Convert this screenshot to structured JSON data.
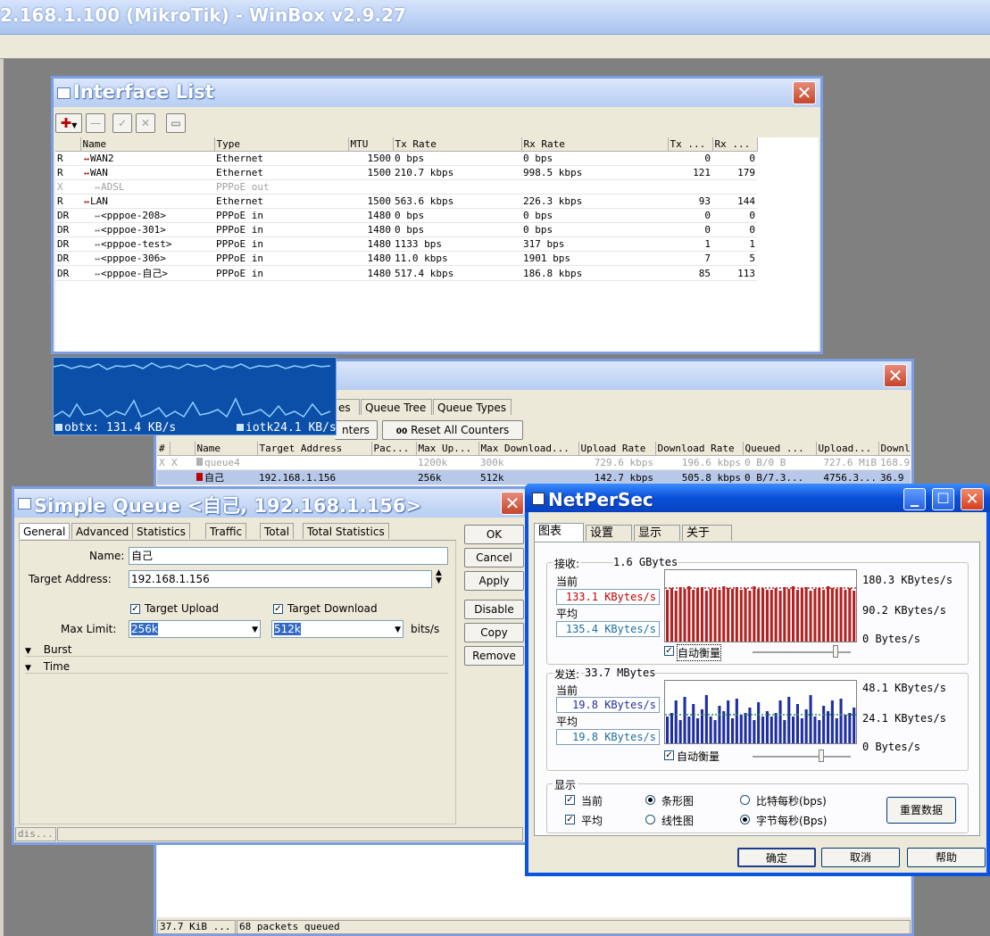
{
  "app": {
    "title": "2.168.1.100 (MikroTik) - WinBox v2.9.27"
  },
  "interface_list": {
    "title": "Interface List",
    "columns": [
      "Name",
      "Type",
      "MTU",
      "Tx Rate",
      "Rx Rate",
      "Tx ...",
      "Rx ..."
    ],
    "rows": [
      {
        "flag": "R",
        "name": "WAN2",
        "type": "Ethernet",
        "mtu": "1500",
        "tx": "0 bps",
        "rx": "0 bps",
        "txp": "0",
        "rxp": "0",
        "disabled": false,
        "indent": false
      },
      {
        "flag": "R",
        "name": "WAN",
        "type": "Ethernet",
        "mtu": "1500",
        "tx": "210.7 kbps",
        "rx": "998.5 kbps",
        "txp": "121",
        "rxp": "179",
        "disabled": false,
        "indent": false
      },
      {
        "flag": "X",
        "name": "ADSL",
        "type": "PPPoE out",
        "mtu": "",
        "tx": "",
        "rx": "",
        "txp": "",
        "rxp": "",
        "disabled": true,
        "indent": true
      },
      {
        "flag": "R",
        "name": "LAN",
        "type": "Ethernet",
        "mtu": "1500",
        "tx": "563.6 kbps",
        "rx": "226.3 kbps",
        "txp": "93",
        "rxp": "144",
        "disabled": false,
        "indent": false
      },
      {
        "flag": "DR",
        "name": "<pppoe-208>",
        "type": "PPPoE in",
        "mtu": "1480",
        "tx": "0 bps",
        "rx": "0 bps",
        "txp": "0",
        "rxp": "0",
        "disabled": false,
        "indent": true
      },
      {
        "flag": "DR",
        "name": "<pppoe-301>",
        "type": "PPPoE in",
        "mtu": "1480",
        "tx": "0 bps",
        "rx": "0 bps",
        "txp": "0",
        "rxp": "0",
        "disabled": false,
        "indent": true
      },
      {
        "flag": "DR",
        "name": "<pppoe-test>",
        "type": "PPPoE in",
        "mtu": "1480",
        "tx": "1133 bps",
        "rx": "317 bps",
        "txp": "1",
        "rxp": "1",
        "disabled": false,
        "indent": true
      },
      {
        "flag": "DR",
        "name": "<pppoe-306>",
        "type": "PPPoE in",
        "mtu": "1480",
        "tx": "11.0 kbps",
        "rx": "1901 bps",
        "txp": "7",
        "rxp": "5",
        "disabled": false,
        "indent": true
      },
      {
        "flag": "DR",
        "name": "<pppoe-自己>",
        "type": "PPPoE in",
        "mtu": "1480",
        "tx": "517.4 kbps",
        "rx": "186.8 kbps",
        "txp": "85",
        "rxp": "113",
        "disabled": false,
        "indent": true
      }
    ]
  },
  "mini_graph": {
    "tx_label": "obtx: 131.4 KB/s",
    "rx_label": "iotk24.1 KB/s"
  },
  "queue_list": {
    "tabs": [
      "es",
      "Queue Tree",
      "Queue Types"
    ],
    "reset_counters_partial": "nters",
    "reset_all_label": "Reset All Counters",
    "reset_all_icon_text": "00",
    "columns": [
      "#",
      "Name",
      "Target Address",
      "Pac...",
      "Max Up...",
      "Max Download...",
      "Upload Rate",
      "Download Rate",
      "Queued ...",
      "Upload...",
      "Downl"
    ],
    "rows": [
      {
        "idx": "X",
        "name": "queue4",
        "target": "",
        "pac": "",
        "maxup": "1200k",
        "maxdown": "300k",
        "uprate": "729.6 kbps",
        "downrate": "196.6 kbps",
        "queued": "0 B/0 B",
        "upload": "727.6 MiB",
        "down": "168.9",
        "disabled": true
      },
      {
        "idx": "",
        "name": "自己",
        "target": "192.168.1.156",
        "pac": "",
        "maxup": "256k",
        "maxdown": "512k",
        "uprate": "142.7 kbps",
        "downrate": "505.8 kbps",
        "queued": "0 B/7.3...",
        "upload": "4756.3...",
        "down": "36.9",
        "disabled": false
      }
    ],
    "status_left": "37.7 KiB ...",
    "status_right": "68 packets queued"
  },
  "simple_queue": {
    "title": "Simple Queue <自己, 192.168.1.156>",
    "tabs": [
      "General",
      "Advanced",
      "Statistics",
      "Traffic",
      "Total",
      "Total Statistics"
    ],
    "name_label": "Name:",
    "name_value": "自己",
    "target_label": "Target Address:",
    "target_value": "192.168.1.156",
    "upload_check_label": "Target Upload",
    "download_check_label": "Target Download",
    "max_limit_label": "Max Limit:",
    "max_up_value": "256k",
    "max_down_value": "512k",
    "units": "bits/s",
    "burst_label": "Burst",
    "time_label": "Time",
    "buttons": [
      "OK",
      "Cancel",
      "Apply",
      "Disable",
      "Copy",
      "Remove"
    ],
    "status": "dis..."
  },
  "netpersec": {
    "title": "NetPerSec",
    "tabs": [
      "图表",
      "设置",
      "显示",
      "关于"
    ],
    "recv": {
      "header": "接收:",
      "total": "1.6 GBytes",
      "current_label": "当前",
      "current_value": "133.1 KBytes/s",
      "avg_label": "平均",
      "avg_value": "135.4 KBytes/s",
      "scale_top": "180.3 KBytes/s",
      "scale_mid": "90.2 KBytes/s",
      "scale_bottom": "0  Bytes/s",
      "auto_scale": "自动衡量"
    },
    "send": {
      "header": "发送:",
      "total": "33.7 MBytes",
      "current_label": "当前",
      "current_value": "19.8 KBytes/s",
      "avg_label": "平均",
      "avg_value": "19.8 KBytes/s",
      "scale_top": "48.1 KBytes/s",
      "scale_mid": "24.1 KBytes/s",
      "scale_bottom": "0  Bytes/s",
      "auto_scale": "自动衡量"
    },
    "display": {
      "header": "显示",
      "show_current": "当前",
      "show_avg": "平均",
      "bar_chart": "条形图",
      "line_chart": "线性图",
      "bits": "比特每秒(bps)",
      "bytes": "字节每秒(Bps)",
      "reset": "重置数据"
    },
    "buttons": {
      "ok": "确定",
      "cancel": "取消",
      "help": "帮助"
    },
    "colors": {
      "recv_bar": "#b22222",
      "send_bar": "#1f2fa0",
      "avg_line": "#2e8b57",
      "current_text": "#c00000",
      "avg_text": "#1a6ea0",
      "send_text": "#1f2fa0"
    }
  }
}
